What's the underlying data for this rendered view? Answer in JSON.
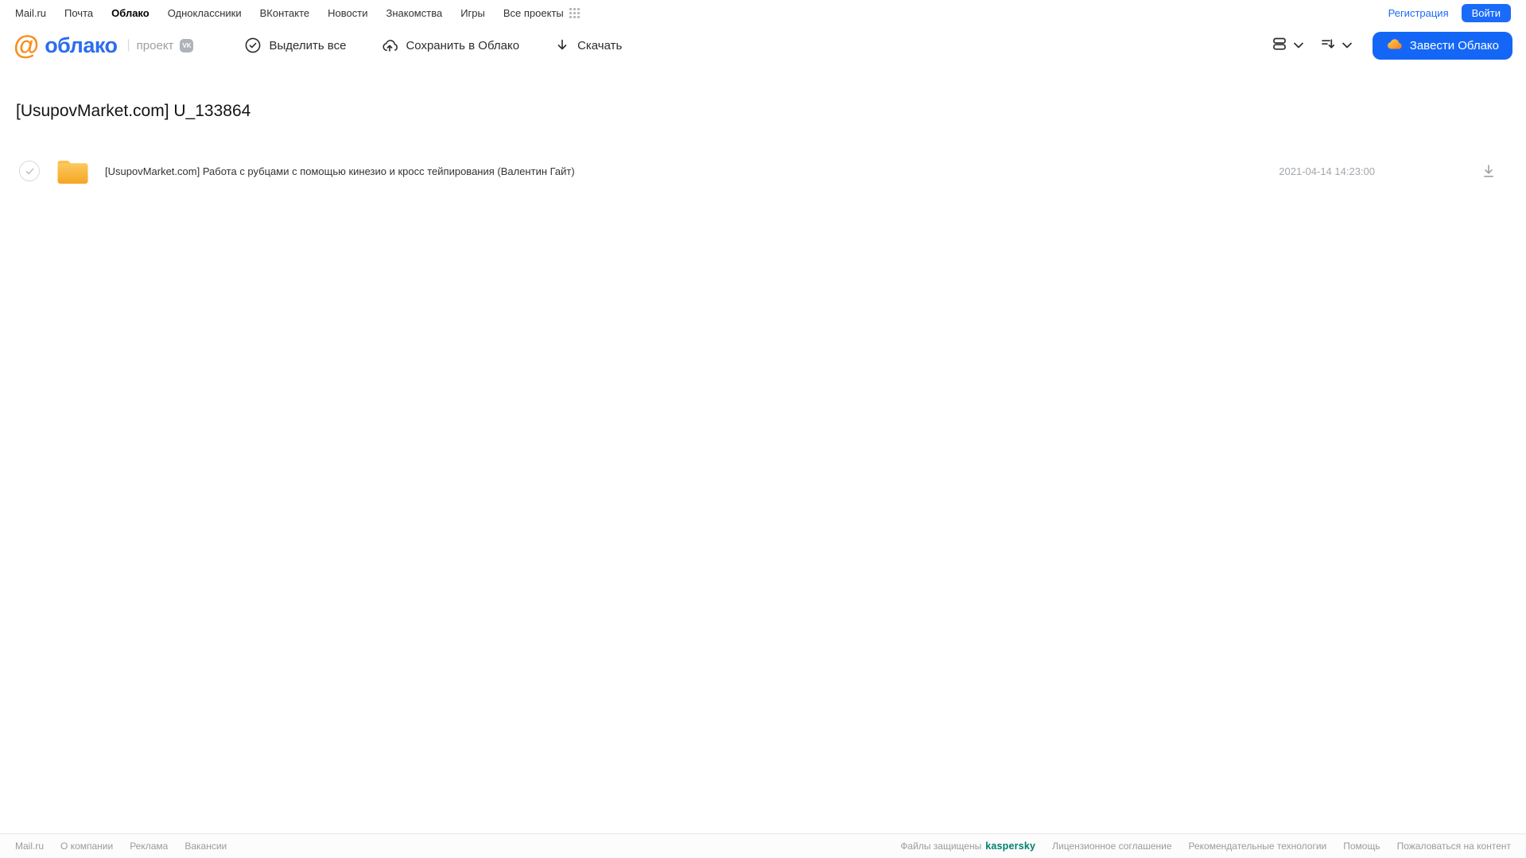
{
  "portal_nav": {
    "links": [
      "Mail.ru",
      "Почта",
      "Облако",
      "Одноклассники",
      "ВКонтакте",
      "Новости",
      "Знакомства",
      "Игры",
      "Все проекты"
    ],
    "registration_label": "Регистрация",
    "login_label": "Войти"
  },
  "header": {
    "logo_at": "@",
    "logo_text": "облако",
    "project_label": "проект",
    "vk_badge": "vk",
    "actions": [
      {
        "label": "Выделить все",
        "icon": "check-circle-icon"
      },
      {
        "label": "Сохранить в Облако",
        "icon": "cloud-upload-icon"
      },
      {
        "label": "Скачать",
        "icon": "download-icon"
      }
    ],
    "create_cloud_label": "Завести Облако"
  },
  "main": {
    "title": "[UsupovMarket.com] U_133864",
    "files": [
      {
        "type": "folder",
        "name": "[UsupovMarket.com] Работа с рубцами с помощью кинезио и кросс тейпирования (Валентин Гайт)",
        "date": "2021-04-14 14:23:00"
      }
    ]
  },
  "footer": {
    "left_links": [
      "Mail.ru",
      "О компании",
      "Реклама",
      "Вакансии"
    ],
    "protected_text": "Файлы защищены",
    "kaspersky_label": "kaspersky",
    "right_links": [
      "Лицензионное соглашение",
      "Рекомендательные технологии",
      "Помощь",
      "Пожаловаться на контент"
    ]
  },
  "colors": {
    "accent_blue": "#1a6bf9",
    "logo_blue": "#2b6def",
    "logo_orange": "#f68f1e",
    "folder_yellow": "#f9b234",
    "kaspersky_green": "#00806c",
    "muted_gray": "#9b9b9b"
  }
}
